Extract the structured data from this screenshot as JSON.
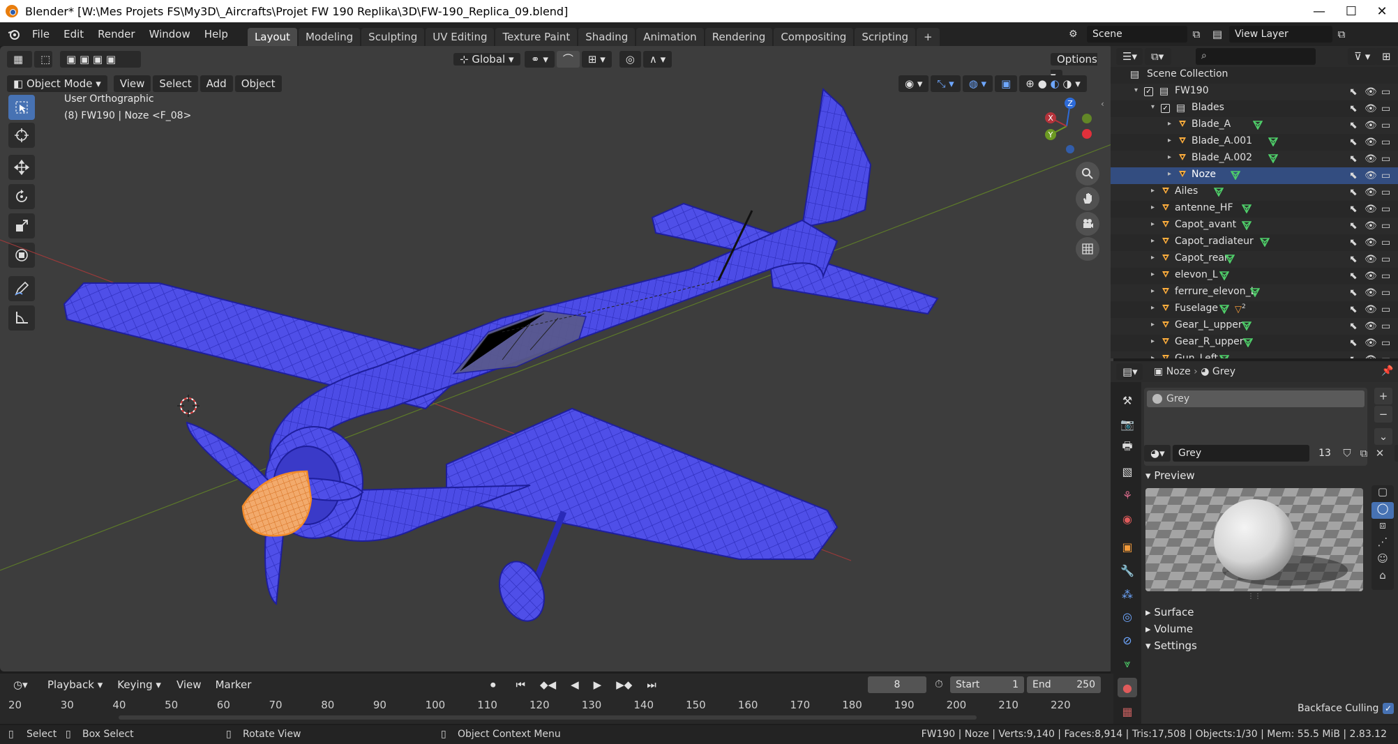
{
  "window": {
    "title": "Blender* [W:\\Mes Projets FS\\My3D\\_Aircrafts\\Projet FW 190 Replika\\3D\\FW-190_Replica_09.blend]",
    "minimize": "—",
    "maximize": "☐",
    "close": "✕"
  },
  "menu": [
    "File",
    "Edit",
    "Render",
    "Window",
    "Help"
  ],
  "workspaces": [
    "Layout",
    "Modeling",
    "Sculpting",
    "UV Editing",
    "Texture Paint",
    "Shading",
    "Animation",
    "Rendering",
    "Compositing",
    "Scripting"
  ],
  "add_workspace": "+",
  "scene": {
    "label": "Scene"
  },
  "view_layer": {
    "label": "View Layer"
  },
  "viewport": {
    "mode": "Object Mode",
    "menus": [
      "View",
      "Select",
      "Add",
      "Object"
    ],
    "transform_orientation": "Global",
    "options": "Options",
    "view_name": "User Orthographic",
    "object_info": "(8) FW190 | Noze <F_08>",
    "gizmo": {
      "x": "X",
      "y": "Y",
      "z": "Z"
    },
    "wire_color": "#2f2fd0",
    "surface_color": "#4f4fe8",
    "selected_color": "#f5a15a"
  },
  "outliner": {
    "search_placeholder": "",
    "rows": [
      {
        "name": "Scene Collection"
      },
      {
        "name": "FW190"
      },
      {
        "name": "Blades"
      },
      {
        "name": "Blade_A"
      },
      {
        "name": "Blade_A.001"
      },
      {
        "name": "Blade_A.002"
      },
      {
        "name": "Noze"
      },
      {
        "name": "Ailes"
      },
      {
        "name": "antenne_HF"
      },
      {
        "name": "Capot_avant"
      },
      {
        "name": "Capot_radiateur"
      },
      {
        "name": "Capot_rear"
      },
      {
        "name": "elevon_L"
      },
      {
        "name": "ferrure_elevon_L"
      },
      {
        "name": "Fuselage"
      },
      {
        "name": "Gear_L_upper"
      },
      {
        "name": "Gear_R_upper"
      },
      {
        "name": "Gun_Left"
      }
    ],
    "fuselage_badge": "2"
  },
  "properties": {
    "breadcrumb_object": "Noze",
    "breadcrumb_sep": "›",
    "breadcrumb_material": "Grey",
    "slot_name": "Grey",
    "material_name": "Grey",
    "users": "13",
    "sections": {
      "preview": "Preview",
      "surface": "Surface",
      "volume": "Volume",
      "settings": "Settings"
    },
    "backface_culling": "Backface Culling"
  },
  "timeline": {
    "menus": [
      "Playback",
      "Keying",
      "View",
      "Marker"
    ],
    "current_frame": "8",
    "start_label": "Start",
    "start": "1",
    "end_label": "End",
    "end": "250",
    "ticks": [
      "20",
      "30",
      "40",
      "50",
      "60",
      "70",
      "80",
      "90",
      "100",
      "110",
      "120",
      "130",
      "140",
      "150",
      "160",
      "170",
      "180",
      "190",
      "200",
      "210",
      "220"
    ]
  },
  "status": {
    "select": "Select",
    "box_select": "Box Select",
    "rotate_view": "Rotate View",
    "context_menu": "Object Context Menu",
    "stats": "FW190 | Noze | Verts:9,140 | Faces:8,914 | Tris:17,508 | Objects:1/30 | Mem: 55.5 MiB | 2.83.12"
  }
}
